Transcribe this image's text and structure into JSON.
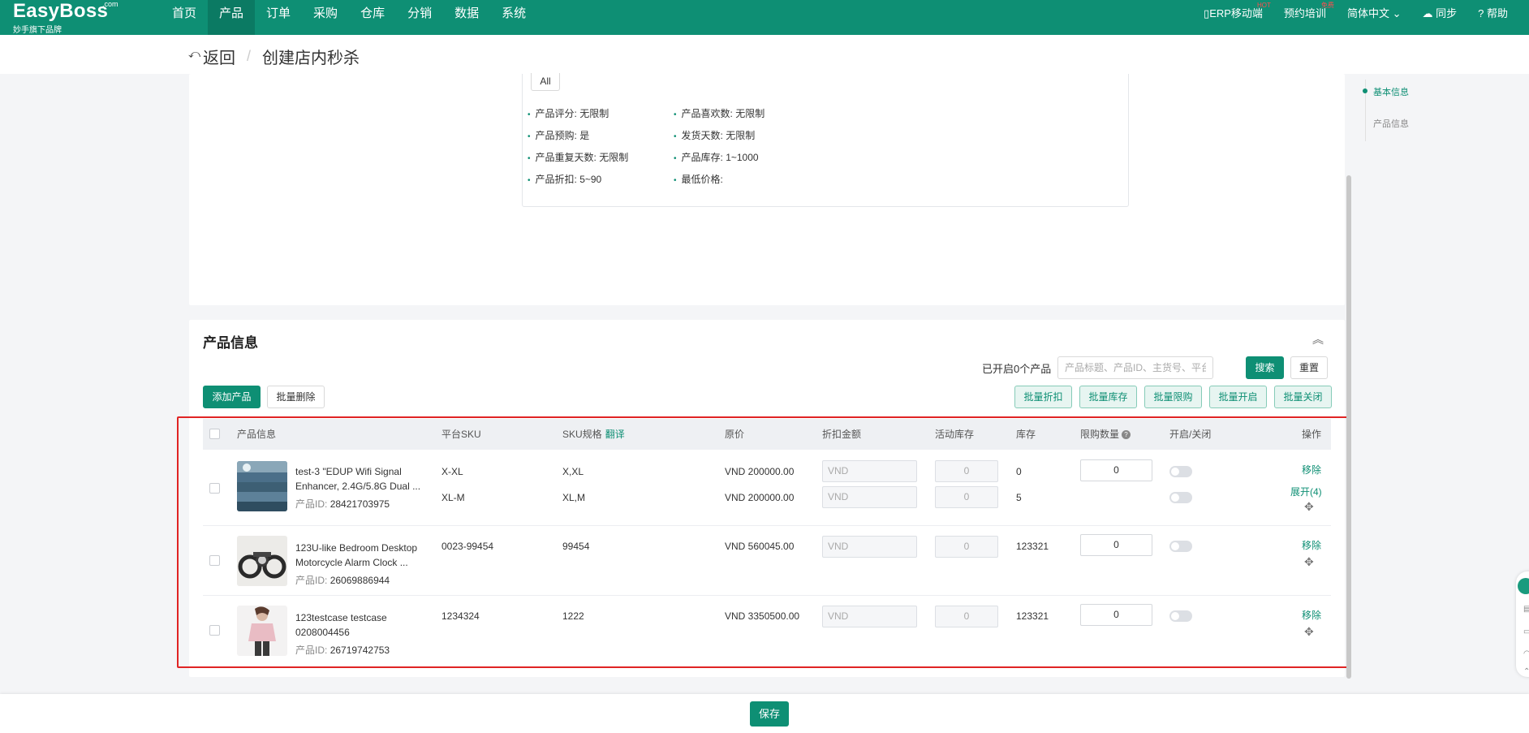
{
  "nav": {
    "logo_main": "EasyBoss",
    "logo_com": ".com",
    "logo_sub": "妙手旗下品牌",
    "items": [
      {
        "label": "首页",
        "active": false
      },
      {
        "label": "产品",
        "active": true
      },
      {
        "label": "订单",
        "active": false
      },
      {
        "label": "采购",
        "active": false
      },
      {
        "label": "仓库",
        "active": false
      },
      {
        "label": "分销",
        "active": false
      },
      {
        "label": "数据",
        "active": false
      },
      {
        "label": "系统",
        "active": false
      }
    ],
    "right": {
      "mobile": "ERP移动端",
      "mobile_badge": "HOT",
      "training": "预约培训",
      "training_badge": "免费",
      "language": "简体中文",
      "sync": "同步",
      "help": "帮助"
    }
  },
  "breadcrumb": {
    "back": "返回",
    "separator": "/",
    "current": "创建店内秒杀"
  },
  "rules": {
    "all_button": "All",
    "items": [
      {
        "label": "产品评分:",
        "value": "无限制"
      },
      {
        "label": "产品喜欢数:",
        "value": "无限制"
      },
      {
        "label": "产品预购:",
        "value": "是"
      },
      {
        "label": "发货天数:",
        "value": "无限制"
      },
      {
        "label": "产品重复天数:",
        "value": "无限制"
      },
      {
        "label": "产品库存:",
        "value": "1~1000"
      },
      {
        "label": "产品折扣:",
        "value": "5~90"
      },
      {
        "label": "最低价格:",
        "value": ""
      }
    ]
  },
  "product_section": {
    "title": "产品信息",
    "enabled_count_label": "已开启0个产品",
    "search_placeholder": "产品标题、产品ID、主货号、平台SKU",
    "search_button": "搜索",
    "reset_button": "重置",
    "add_product_button": "添加产品",
    "batch_delete_button": "批量删除",
    "batch_buttons": [
      "批量折扣",
      "批量库存",
      "批量限购",
      "批量开启",
      "批量关闭"
    ]
  },
  "table": {
    "headers": {
      "product_info": "产品信息",
      "platform_sku": "平台SKU",
      "sku_spec": "SKU规格",
      "translate": "翻译",
      "original_price": "原价",
      "discount_amount": "折扣金额",
      "activity_stock": "活动库存",
      "stock": "库存",
      "purchase_limit": "限购数量",
      "toggle": "开启/关闭",
      "actions": "操作"
    },
    "id_label": "产品ID:",
    "discount_placeholder": "VND",
    "remove_label": "移除",
    "rows": [
      {
        "name": "test-3 \"EDUP Wifi Signal Enhancer, 2.4G/5.8G Dual ...",
        "id": "28421703975",
        "limit": "0",
        "expand": "展开(4)",
        "skus": [
          {
            "sku": "X-XL",
            "spec": "X,XL",
            "price": "VND 200000.00",
            "activity_stock": "0",
            "stock": "0"
          },
          {
            "sku": "XL-M",
            "spec": "XL,M",
            "price": "VND 200000.00",
            "activity_stock": "0",
            "stock": "5"
          }
        ]
      },
      {
        "name": "123U-like Bedroom Desktop Motorcycle Alarm Clock ...",
        "id": "26069886944",
        "limit": "0",
        "skus": [
          {
            "sku": "0023-99454",
            "spec": "99454",
            "price": "VND 560045.00",
            "activity_stock": "0",
            "stock": "123321"
          }
        ]
      },
      {
        "name": "123testcase testcase 0208004456",
        "id": "26719742753",
        "limit": "0",
        "skus": [
          {
            "sku": "1234324",
            "spec": "1222",
            "price": "VND 3350500.00",
            "activity_stock": "0",
            "stock": "123321"
          }
        ]
      }
    ]
  },
  "anchor_nav": {
    "items": [
      "基本信息",
      "产品信息"
    ],
    "active_color": "#0e8f74"
  },
  "footer": {
    "save_button": "保存"
  },
  "colors": {
    "brand": "#0e8f74",
    "highlight": "#e02424"
  }
}
